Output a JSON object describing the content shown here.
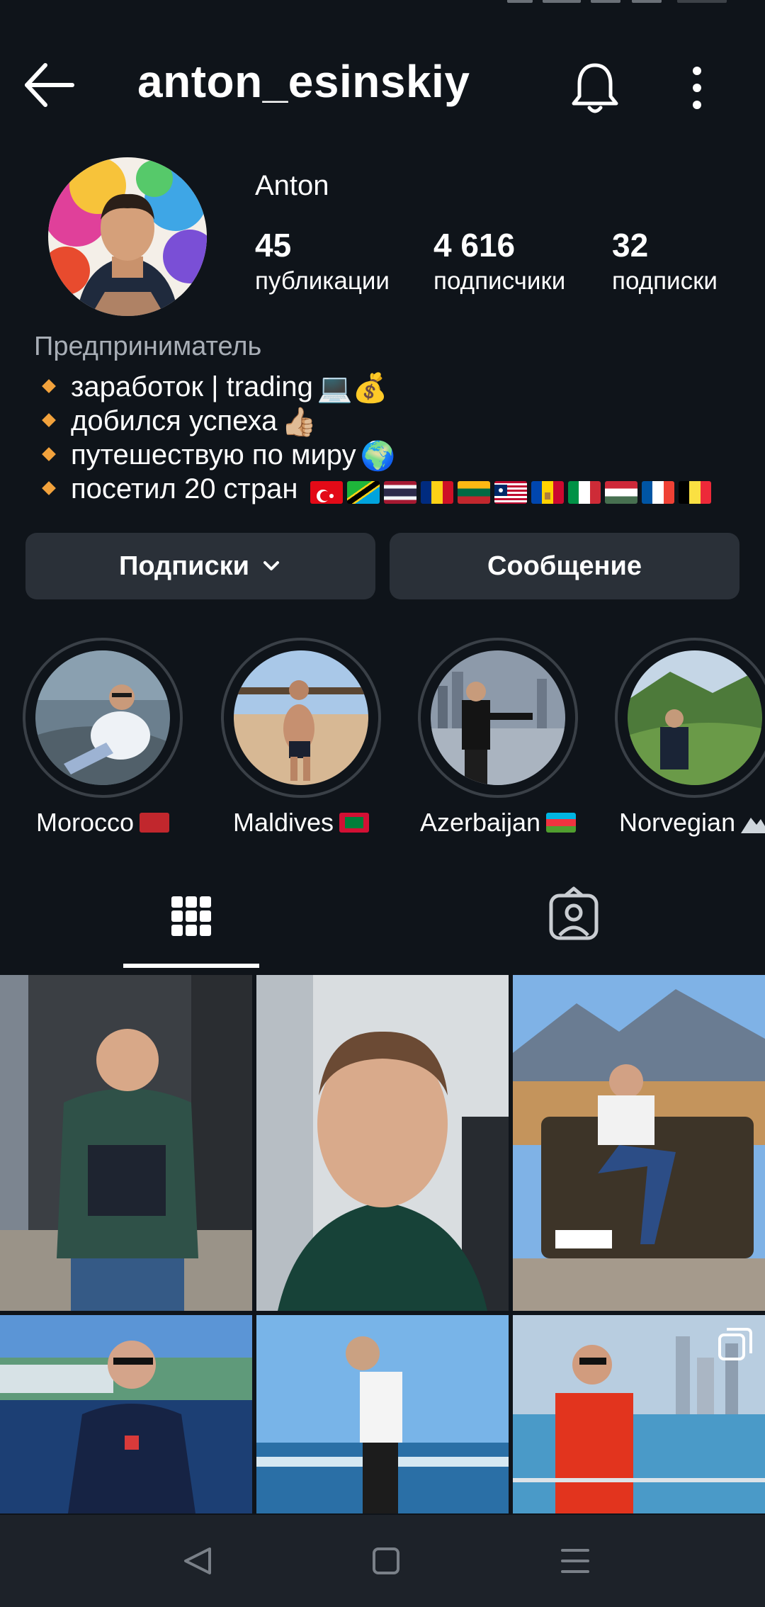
{
  "header": {
    "username": "anton_esinskiy",
    "icons": [
      "back-arrow-icon",
      "bell-icon",
      "more-vertical-icon"
    ]
  },
  "profile": {
    "name": "Anton",
    "stats": [
      {
        "value": "45",
        "label": "публикации"
      },
      {
        "value": "4 616",
        "label": "подписчики"
      },
      {
        "value": "32",
        "label": "подписки"
      }
    ],
    "category": "Предприниматель",
    "bio": [
      {
        "text": "заработок | trading",
        "emoji": "💻💰"
      },
      {
        "text": "добился успеха",
        "emoji": "👍🏼"
      },
      {
        "text": "путешествую по миру",
        "emoji": "🌍"
      },
      {
        "text": "посетил 20 стран",
        "emoji": ""
      }
    ],
    "flags": [
      "turkey",
      "tanzania",
      "thailand",
      "romania",
      "lithuania",
      "liberia",
      "moldova",
      "italy",
      "hungary",
      "france",
      "belgium"
    ]
  },
  "actions": {
    "follow_label": "Подписки",
    "message_label": "Сообщение"
  },
  "highlights": [
    {
      "label": "Morocco",
      "flag": "morocco"
    },
    {
      "label": "Maldives",
      "flag": "maldives"
    },
    {
      "label": "Azerbaijan",
      "flag": "azerbaijan"
    },
    {
      "label": "Norvegian",
      "flag": "mountain"
    }
  ],
  "tabs": [
    "grid-icon",
    "tagged-icon"
  ],
  "nav": [
    "back-triangle-icon",
    "home-square-icon",
    "menu-lines-icon"
  ],
  "colors": {
    "background": "#0f141a",
    "button": "#2a3038",
    "bullet": "#f2a23c",
    "muted": "#a8aeb6"
  }
}
